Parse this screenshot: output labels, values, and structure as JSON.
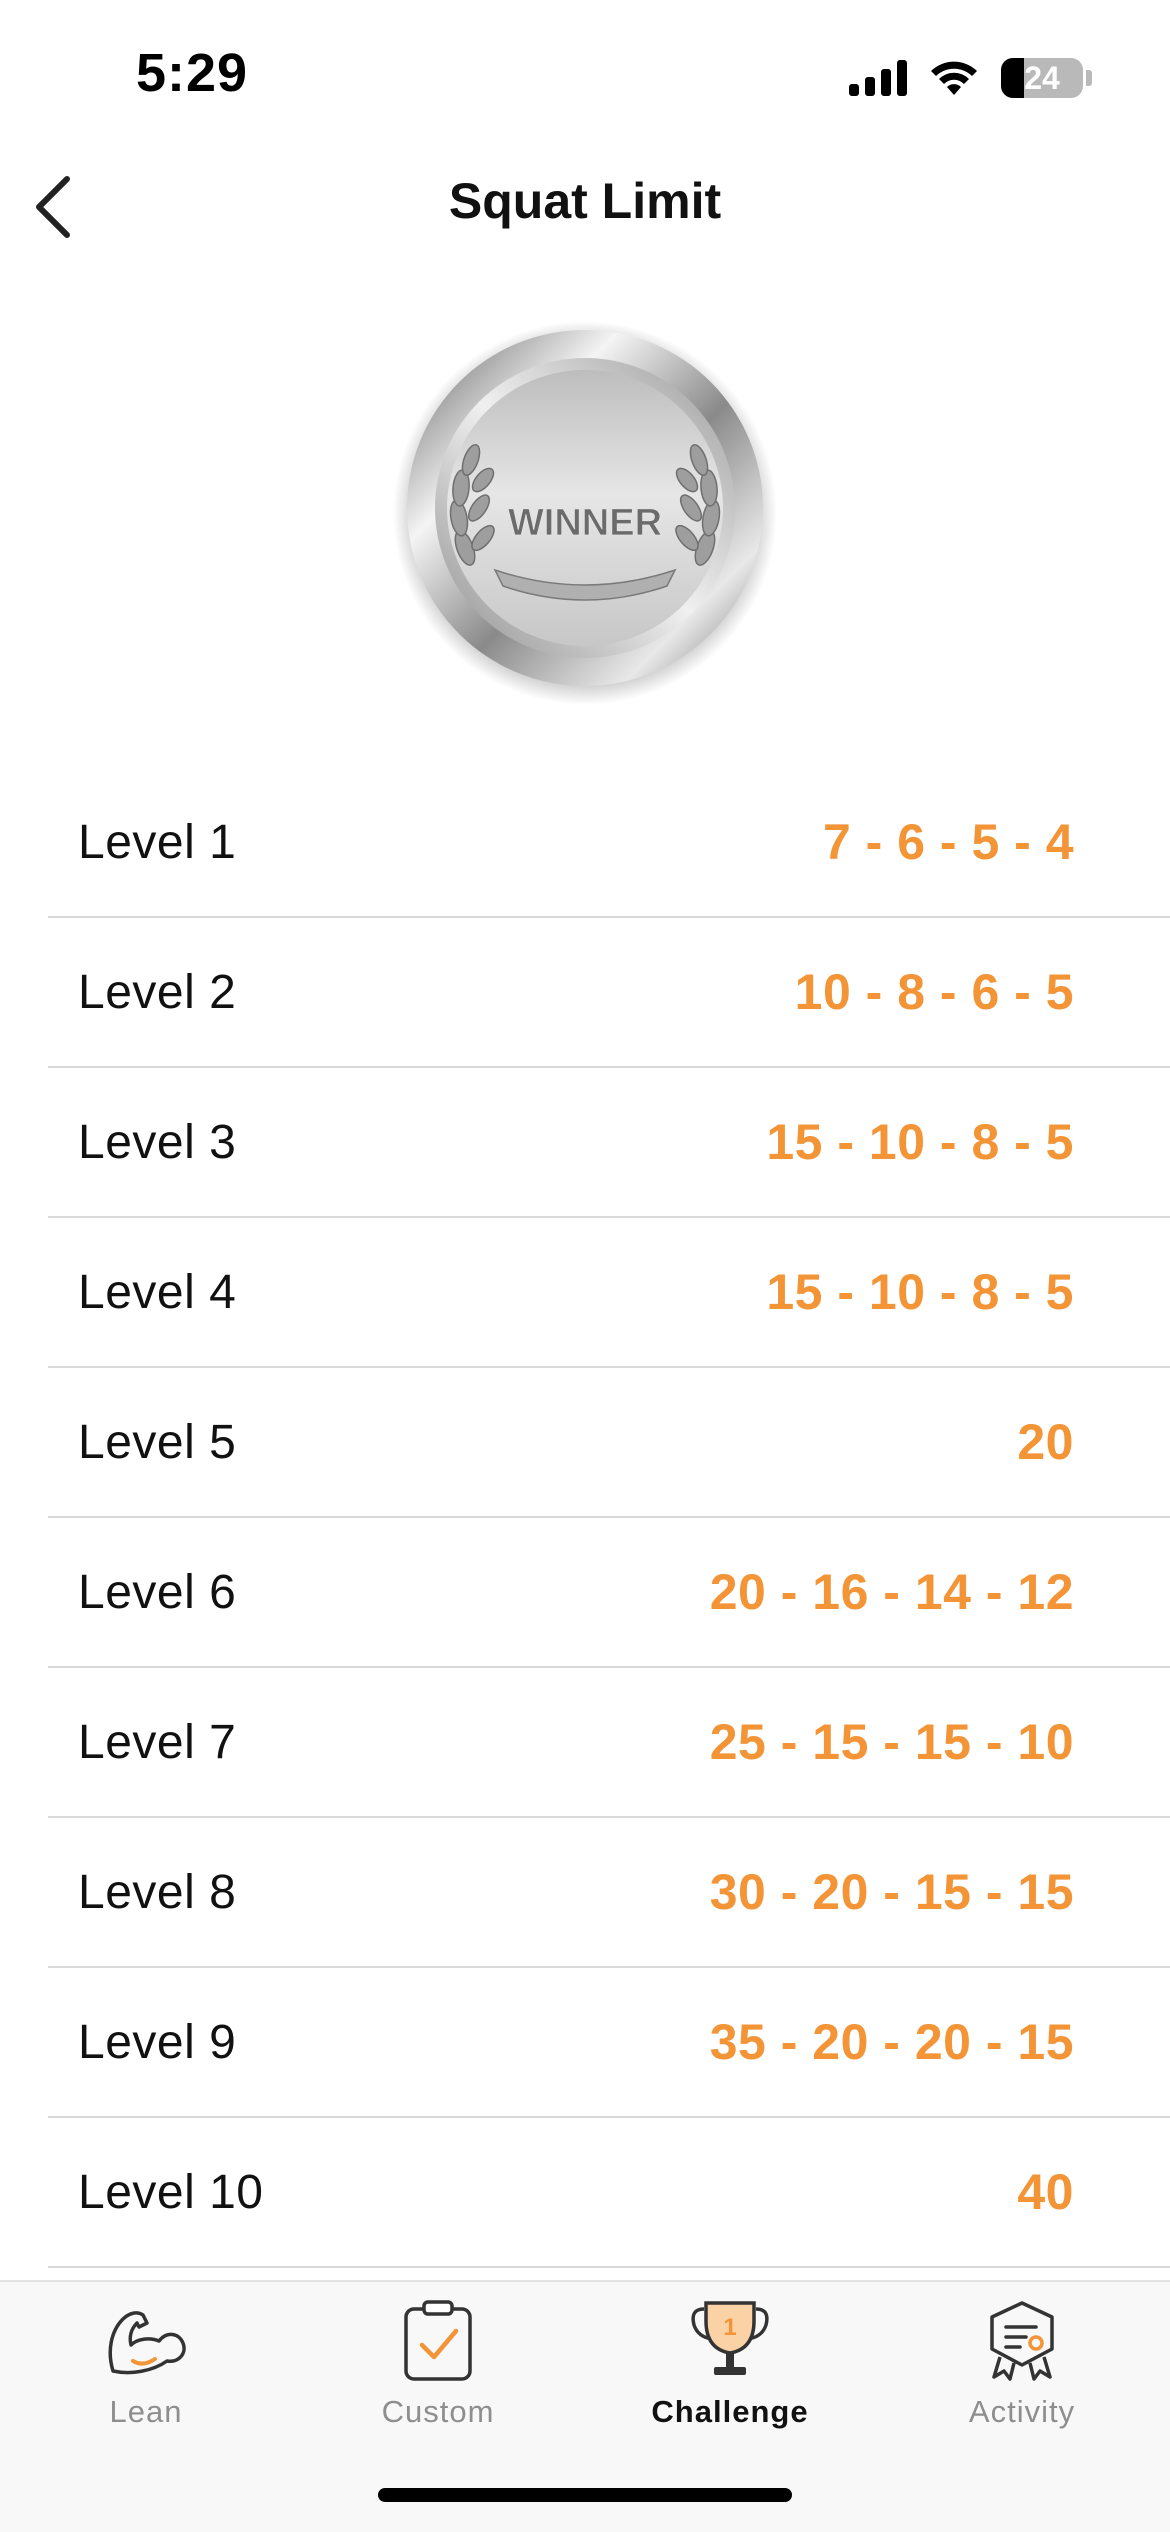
{
  "status_bar": {
    "time": "5:29",
    "battery_percent": "24",
    "icons": [
      "signal-icon",
      "wifi-icon",
      "battery-icon"
    ]
  },
  "nav": {
    "title": "Squat Limit",
    "back_icon": "chevron-left-icon"
  },
  "medal": {
    "text": "WINNER",
    "icon": "silver-medal-icon"
  },
  "levels": [
    {
      "name": "Level 1",
      "reps": "7 - 6 - 5 - 4"
    },
    {
      "name": "Level 2",
      "reps": "10 - 8 - 6 - 5"
    },
    {
      "name": "Level 3",
      "reps": "15 - 10 - 8 - 5"
    },
    {
      "name": "Level 4",
      "reps": "15 - 10 - 8 - 5"
    },
    {
      "name": "Level 5",
      "reps": "20"
    },
    {
      "name": "Level 6",
      "reps": "20 - 16 - 14 - 12"
    },
    {
      "name": "Level 7",
      "reps": "25 - 15 - 15 - 10"
    },
    {
      "name": "Level 8",
      "reps": "30 - 20 - 15 - 15"
    },
    {
      "name": "Level 9",
      "reps": "35 - 20 - 20 - 15"
    },
    {
      "name": "Level 10",
      "reps": "40"
    }
  ],
  "tabs": [
    {
      "label": "Lean",
      "icon": "flexed-arm-icon",
      "active": false
    },
    {
      "label": "Custom",
      "icon": "clipboard-check-icon",
      "active": false
    },
    {
      "label": "Challenge",
      "icon": "trophy-icon",
      "active": true,
      "badge": "1"
    },
    {
      "label": "Activity",
      "icon": "certificate-badge-icon",
      "active": false
    }
  ],
  "colors": {
    "accent": "#F39437",
    "text": "#111111",
    "muted": "#8E8E8E",
    "divider": "#D9D9D9"
  }
}
